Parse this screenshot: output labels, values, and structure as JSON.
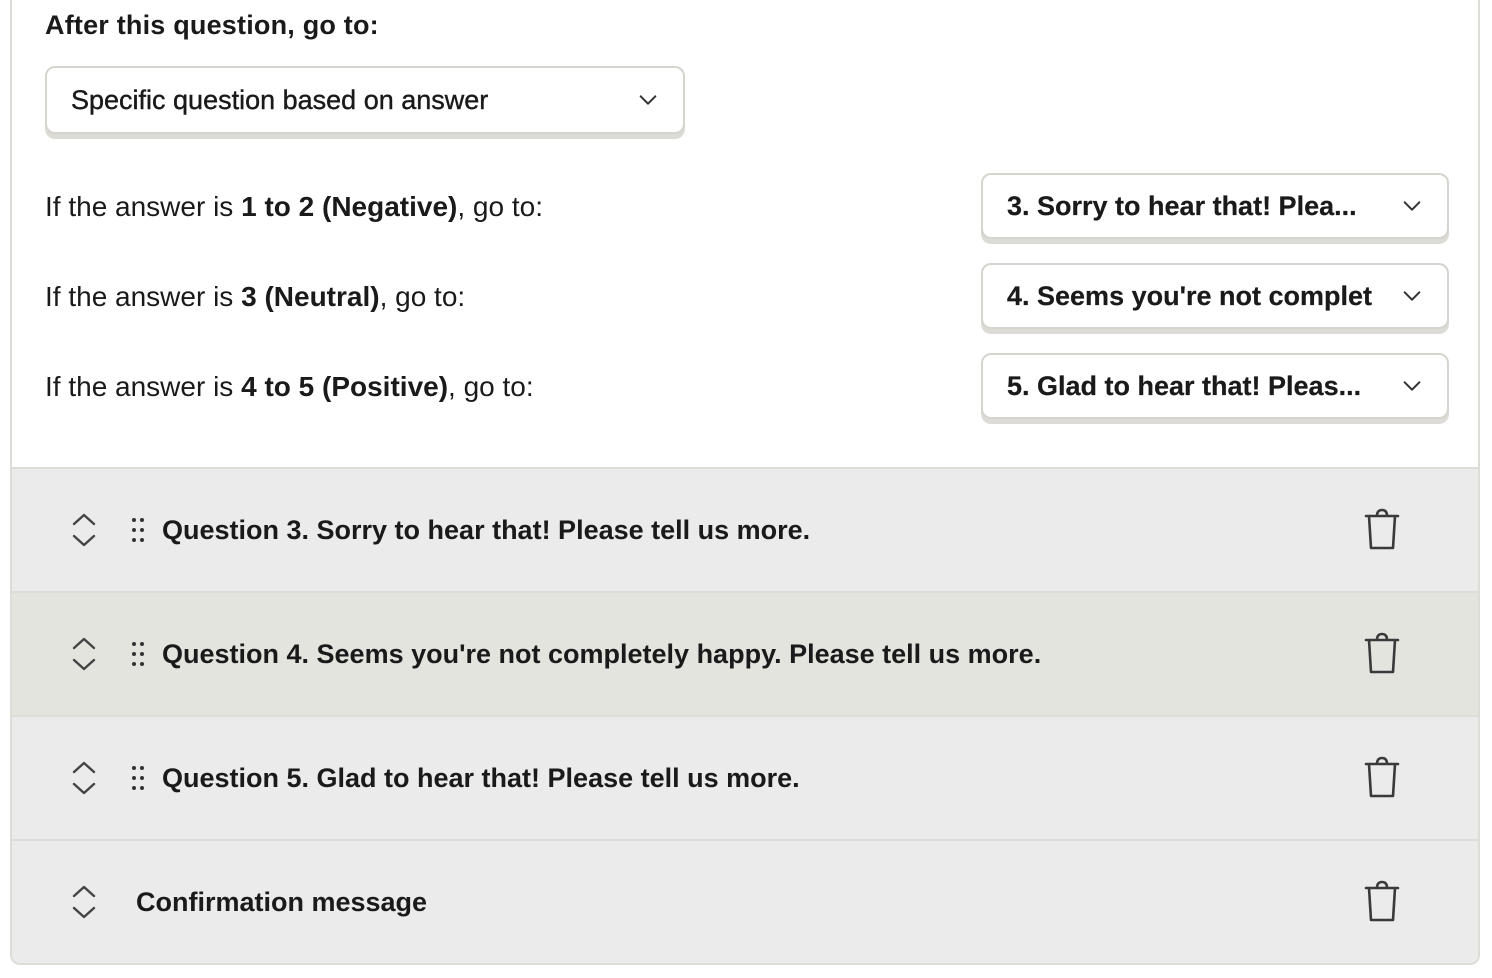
{
  "logic": {
    "after_label": "After this question, go to:",
    "main_select_value": "Specific question based on answer",
    "rules": [
      {
        "prefix": "If the answer is ",
        "range": "1 to 2 (Negative)",
        "suffix": ", go to:",
        "target": "3. Sorry to hear that! Plea..."
      },
      {
        "prefix": "If the answer is ",
        "range": "3 (Neutral)",
        "suffix": ", go to:",
        "target": "4. Seems you're not complet"
      },
      {
        "prefix": "If the answer is ",
        "range": "4 to 5 (Positive)",
        "suffix": ", go to:",
        "target": "5. Glad to hear that! Pleas..."
      }
    ]
  },
  "questions": [
    {
      "title": "Question 3. Sorry to hear that! Please tell us more.",
      "highlighted": false
    },
    {
      "title": "Question 4. Seems you're not completely happy. Please tell us more.",
      "highlighted": true
    },
    {
      "title": "Question 5. Glad to hear that! Please tell us more.",
      "highlighted": false
    }
  ],
  "confirmation": {
    "title": "Confirmation message"
  },
  "icons": {
    "expand": "expand-collapse-icon",
    "drag": "drag-handle-icon",
    "delete": "trash-icon",
    "dropdown": "chevron-down-icon"
  },
  "colors": {
    "row_bg": "#ebebeb",
    "row_highlight_bg": "#e4e4df",
    "border": "#dddcd6",
    "text": "#1a1a1a"
  }
}
